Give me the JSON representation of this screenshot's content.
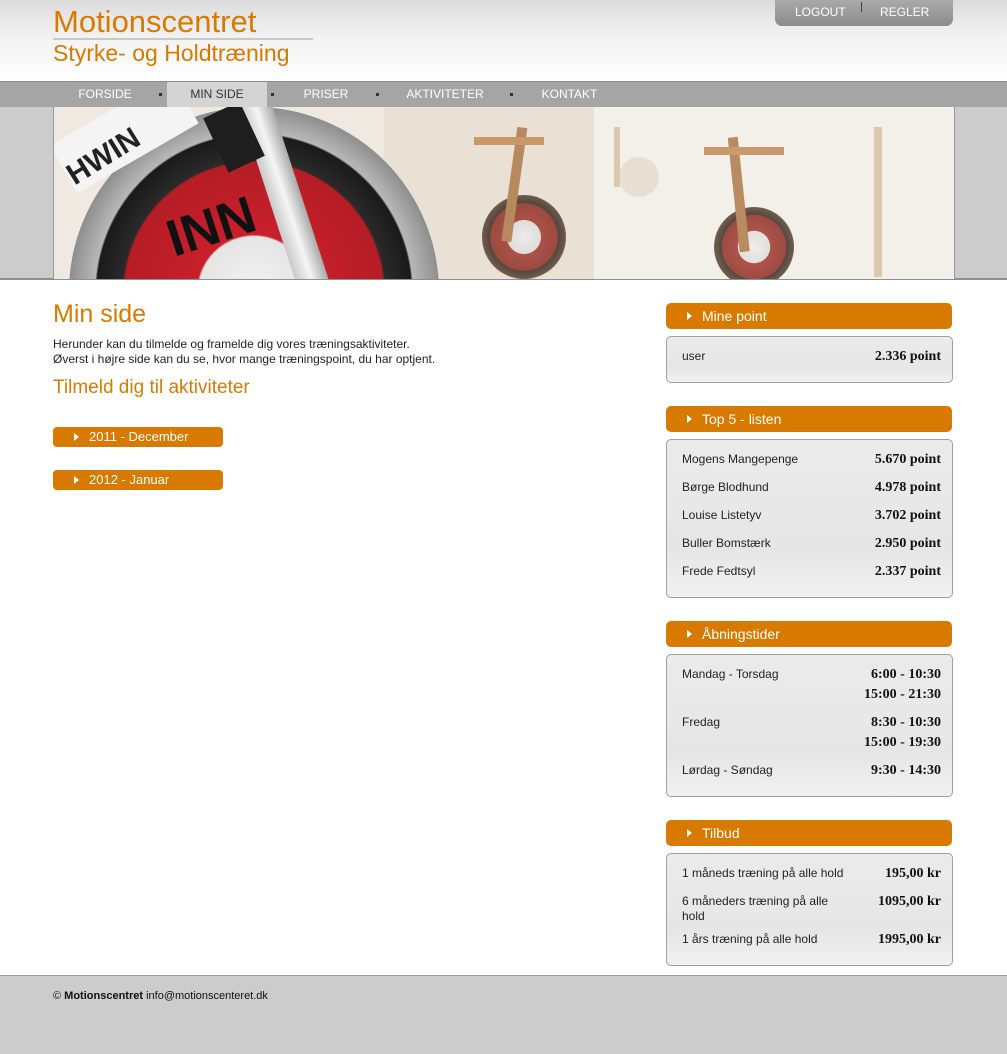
{
  "header": {
    "title": "Motionscentret",
    "subtitle": "Styrke- og Holdtræning",
    "logout": "LOGOUT",
    "regler": "REGLER"
  },
  "nav": {
    "items": [
      "FORSIDE",
      "MIN SIDE",
      "PRISER",
      "AKTIVITETER",
      "KONTAKT"
    ],
    "active": "MIN SIDE"
  },
  "main": {
    "title": "Min side",
    "intro_line1": "Herunder kan du tilmelde og framelde dig vores træningsaktiviteter.",
    "intro_line2": "Øverst i højre side kan du se, hvor mange træningspoint, du har optjent.",
    "subtitle": "Tilmeld dig til aktiviteter",
    "months": [
      "2011 - December",
      "2012 - Januar"
    ]
  },
  "sidebar": {
    "mine_point": {
      "title": "Mine point",
      "user": "user",
      "points": "2.336 point"
    },
    "top5": {
      "title": "Top 5 - listen",
      "rows": [
        {
          "name": "Mogens Mangepenge",
          "points": "5.670 point"
        },
        {
          "name": "Børge Blodhund",
          "points": "4.978 point"
        },
        {
          "name": "Louise Listetyv",
          "points": "3.702 point"
        },
        {
          "name": "Buller Bomstærk",
          "points": "2.950 point"
        },
        {
          "name": "Frede Fedtsyl",
          "points": "2.337 point"
        }
      ]
    },
    "hours": {
      "title": "Åbningstider",
      "rows": [
        {
          "day": "Mandag - Torsdag",
          "times": [
            "6:00 - 10:30",
            "15:00 - 21:30"
          ]
        },
        {
          "day": "Fredag",
          "times": [
            "8:30 - 10:30",
            "15:00 - 19:30"
          ]
        },
        {
          "day": "Lørdag - Søndag",
          "times": [
            "9:30 - 14:30"
          ]
        }
      ]
    },
    "offers": {
      "title": "Tilbud",
      "rows": [
        {
          "label": "1 måneds træning på alle hold",
          "price": "195,00 kr"
        },
        {
          "label": "6 måneders træning på alle hold",
          "price": "1095,00 kr"
        },
        {
          "label": "1 års træning på alle hold",
          "price": "1995,00 kr"
        }
      ]
    }
  },
  "footer": {
    "copyright": "©",
    "brand": "Motionscentret",
    "email": "info@motionscenteret.dk"
  },
  "colors": {
    "accent": "#d97a00",
    "nav_bg": "#a5a5a5",
    "footer_bg": "#cccccc"
  }
}
